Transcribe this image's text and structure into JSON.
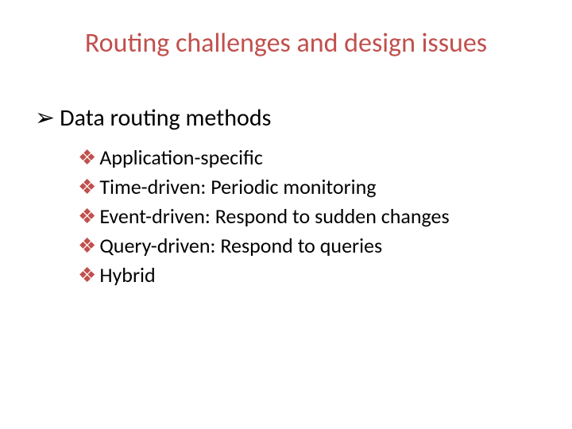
{
  "title": "Routing challenges and design issues",
  "section": {
    "heading": "Data routing methods",
    "items": [
      "Application-specific",
      "Time-driven: Periodic monitoring",
      "Event-driven: Respond to sudden changes",
      "Query-driven: Respond to queries",
      "Hybrid"
    ]
  },
  "bullets": {
    "level1": "➢",
    "level2": "❖"
  }
}
